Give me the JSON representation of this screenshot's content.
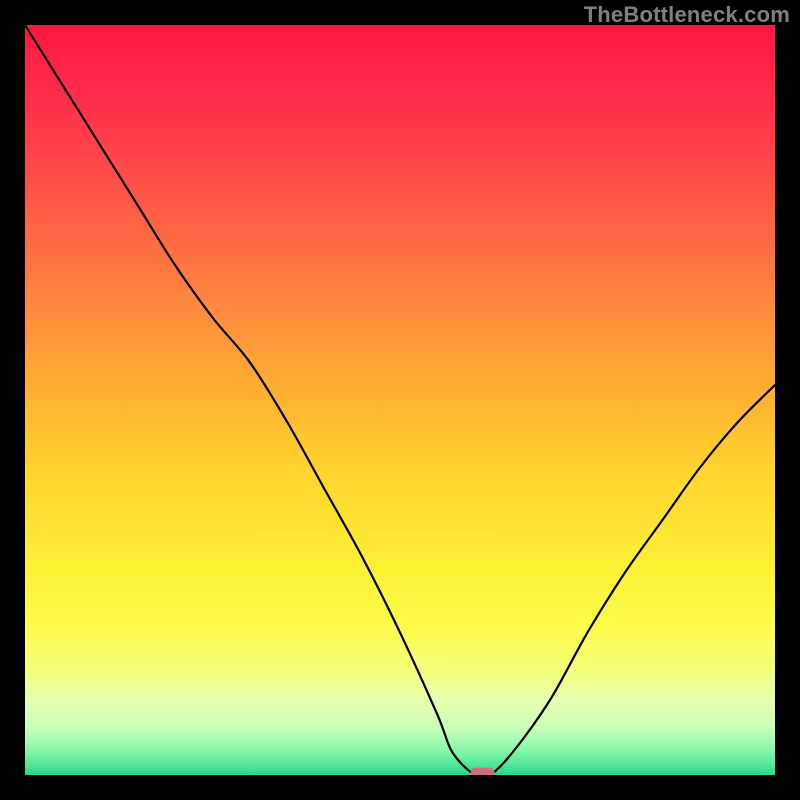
{
  "watermark": "TheBottleneck.com",
  "chart_data": {
    "type": "line",
    "title": "",
    "xlabel": "",
    "ylabel": "",
    "xlim": [
      0,
      100
    ],
    "ylim": [
      0,
      100
    ],
    "grid": false,
    "series": [
      {
        "name": "curve",
        "x": [
          0,
          5,
          10,
          15,
          20,
          25,
          30,
          35,
          40,
          45,
          50,
          55,
          57,
          60,
          62,
          65,
          70,
          75,
          80,
          85,
          90,
          95,
          100
        ],
        "y": [
          100,
          92,
          84,
          76,
          68,
          61,
          55,
          47,
          38,
          29,
          19,
          8,
          3,
          0,
          0,
          3,
          10,
          19,
          27,
          34,
          41,
          47,
          52
        ]
      }
    ],
    "marker": {
      "x": 61,
      "y": 0,
      "color": "#cf6f78"
    },
    "gradient_stops": [
      {
        "offset": 0.0,
        "color": "#ff1744"
      },
      {
        "offset": 0.1,
        "color": "#ff2e4a"
      },
      {
        "offset": 0.22,
        "color": "#ff5348"
      },
      {
        "offset": 0.35,
        "color": "#ff8040"
      },
      {
        "offset": 0.48,
        "color": "#ffad33"
      },
      {
        "offset": 0.6,
        "color": "#ffd52e"
      },
      {
        "offset": 0.72,
        "color": "#fff035"
      },
      {
        "offset": 0.8,
        "color": "#fdfc4a"
      },
      {
        "offset": 0.86,
        "color": "#f5ff7a"
      },
      {
        "offset": 0.9,
        "color": "#e8ffb0"
      },
      {
        "offset": 0.94,
        "color": "#c5ffb8"
      },
      {
        "offset": 0.97,
        "color": "#80f5a8"
      },
      {
        "offset": 1.0,
        "color": "#28d98c"
      }
    ]
  }
}
